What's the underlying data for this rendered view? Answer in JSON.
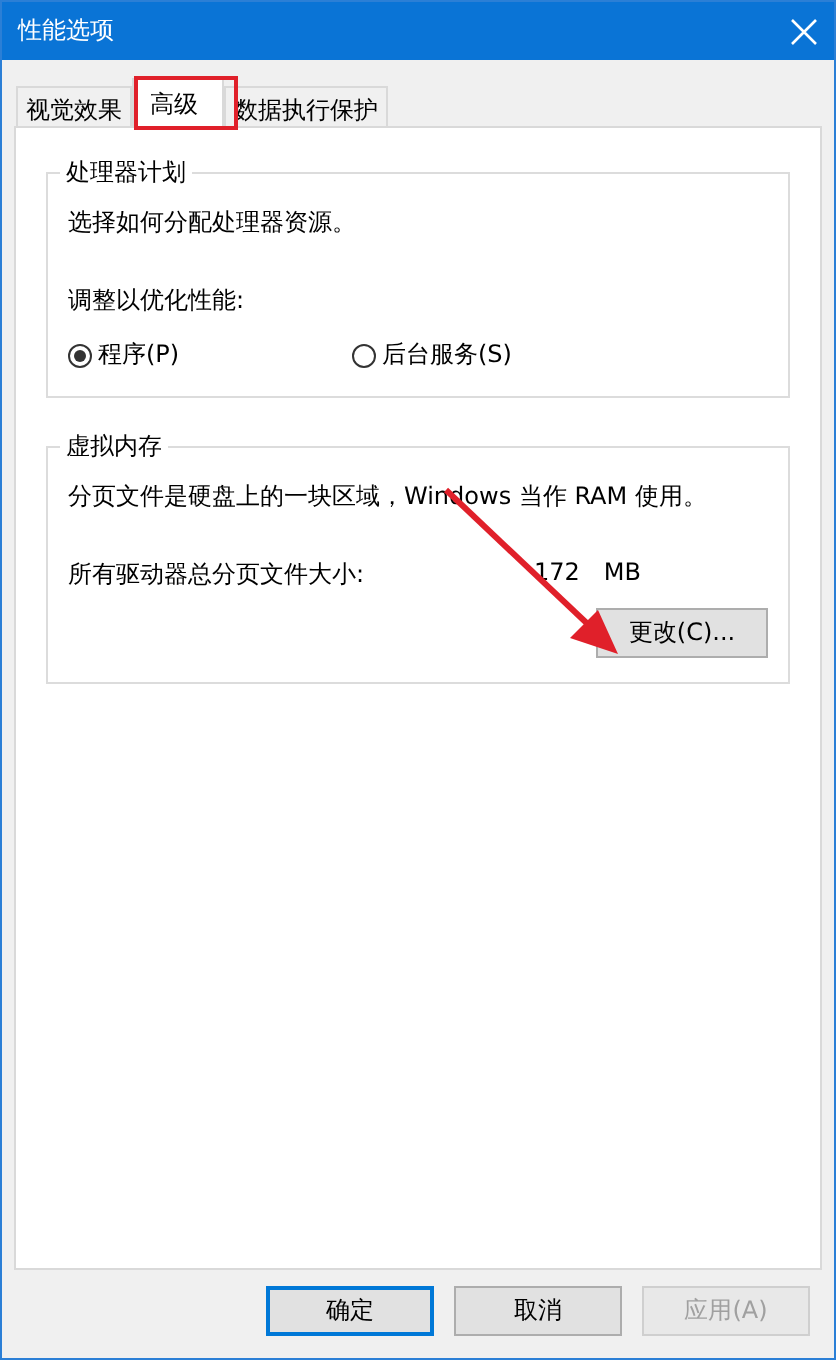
{
  "window": {
    "title": "性能选项"
  },
  "tabs": [
    {
      "label": "视觉效果",
      "selected": false
    },
    {
      "label": "高级",
      "selected": true
    },
    {
      "label": "数据执行保护",
      "selected": false
    }
  ],
  "processor_scheduling": {
    "title": "处理器计划",
    "description": "选择如何分配处理器资源。",
    "prompt": "调整以优化性能:",
    "options": [
      {
        "label": "程序(P)",
        "selected": true
      },
      {
        "label": "后台服务(S)",
        "selected": false
      }
    ]
  },
  "virtual_memory": {
    "title": "虚拟内存",
    "description": "分页文件是硬盘上的一块区域，Windows 当作 RAM 使用。",
    "size_label": "所有驱动器总分页文件大小:",
    "size_value": "172",
    "size_unit": "MB",
    "change_button": "更改(C)..."
  },
  "buttons": [
    {
      "label": "确定",
      "kind": "default",
      "disabled": false
    },
    {
      "label": "取消",
      "kind": "normal",
      "disabled": false
    },
    {
      "label": "应用(A)",
      "kind": "normal",
      "disabled": true
    }
  ]
}
